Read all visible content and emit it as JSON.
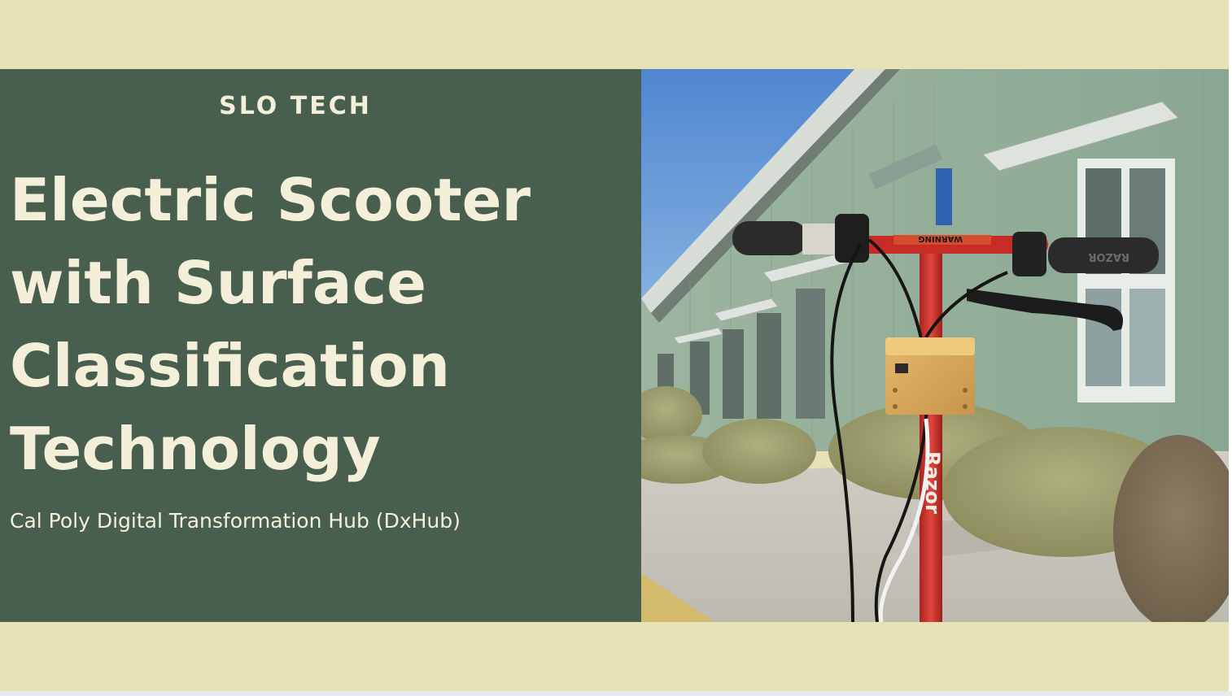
{
  "slide": {
    "kicker": "SLO TECH",
    "title": "Electric Scooter with Surface Classification Technology",
    "subtitle": "Cal Poly Digital Transformation Hub (DxHub)"
  },
  "photo": {
    "handlebar_sticker": "WARNING",
    "grip_brand": "RAZOR",
    "stem_brand": "Razor"
  },
  "colors": {
    "background": "#e6e2b6",
    "panel": "#485e4f",
    "text": "#f4efd8",
    "scooter_red": "#cf2f2b"
  }
}
